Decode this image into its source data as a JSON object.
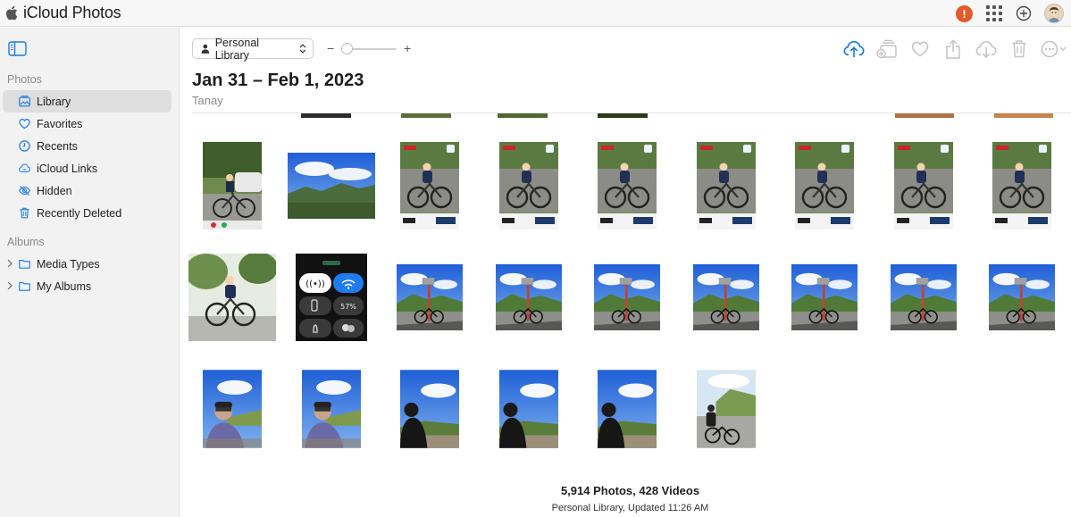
{
  "app": {
    "title": "iCloud Photos",
    "alert_glyph": "!"
  },
  "sidebar": {
    "photos_section": "Photos",
    "items": [
      {
        "label": "Library",
        "icon": "library-icon",
        "active": true
      },
      {
        "label": "Favorites",
        "icon": "heart-icon"
      },
      {
        "label": "Recents",
        "icon": "clock-icon"
      },
      {
        "label": "iCloud Links",
        "icon": "cloud-link-icon"
      },
      {
        "label": "Hidden",
        "icon": "eye-slash-icon"
      },
      {
        "label": "Recently Deleted",
        "icon": "trash-icon"
      }
    ],
    "albums_section": "Albums",
    "albums": [
      {
        "label": "Media Types",
        "icon": "folder-icon"
      },
      {
        "label": "My Albums",
        "icon": "folder-icon"
      }
    ]
  },
  "toolbar": {
    "library_select": "Personal Library",
    "zoom_minus": "−",
    "zoom_plus": "+",
    "zoom_level": 0.1,
    "actions": [
      "upload-icon",
      "add-to-album-icon",
      "favorite-icon",
      "share-icon",
      "download-icon",
      "delete-icon",
      "more-icon"
    ]
  },
  "header": {
    "date_range": "Jan 31 – Feb 1, 2023",
    "location": "Tanay"
  },
  "colors": {
    "accent": "#1a7ae0",
    "alert": "#e25a2c",
    "sidebar_bg": "#f2f2f2",
    "selected_bg": "#dedede"
  },
  "photos": [
    {
      "kind": "cyclist-road-car",
      "orientation": "portrait"
    },
    {
      "kind": "mountain-landscape",
      "orientation": "landscape"
    },
    {
      "kind": "event-photo-cyclist",
      "orientation": "portrait"
    },
    {
      "kind": "event-photo-cyclist",
      "orientation": "portrait"
    },
    {
      "kind": "event-photo-cyclist",
      "orientation": "portrait"
    },
    {
      "kind": "event-photo-cyclist",
      "orientation": "portrait"
    },
    {
      "kind": "event-photo-cyclist",
      "orientation": "portrait"
    },
    {
      "kind": "event-photo-cyclist",
      "orientation": "portrait"
    },
    {
      "kind": "event-photo-cyclist",
      "orientation": "portrait"
    },
    {
      "kind": "cyclist-trees",
      "orientation": "landscape"
    },
    {
      "kind": "control-center-screenshot",
      "orientation": "square",
      "battery": "57%"
    },
    {
      "kind": "bike-sign-blue-sky",
      "orientation": "landscape"
    },
    {
      "kind": "bike-sign-blue-sky",
      "orientation": "square"
    },
    {
      "kind": "bike-sign-blue-sky",
      "orientation": "square"
    },
    {
      "kind": "bike-sign-blue-sky",
      "orientation": "square"
    },
    {
      "kind": "bike-sign-blue-sky",
      "orientation": "square"
    },
    {
      "kind": "bike-sign-blue-sky",
      "orientation": "landscape"
    },
    {
      "kind": "bike-sign-blue-sky",
      "orientation": "square"
    },
    {
      "kind": "selfie-sky",
      "orientation": "portrait"
    },
    {
      "kind": "selfie-sky",
      "orientation": "portrait"
    },
    {
      "kind": "silhouette-sky",
      "orientation": "portrait"
    },
    {
      "kind": "silhouette-sky",
      "orientation": "portrait"
    },
    {
      "kind": "silhouette-sky",
      "orientation": "portrait"
    },
    {
      "kind": "rider-road-hill",
      "orientation": "portrait"
    }
  ],
  "footer": {
    "count": "5,914 Photos, 428 Videos",
    "status": "Personal Library, Updated 11:26 AM"
  }
}
